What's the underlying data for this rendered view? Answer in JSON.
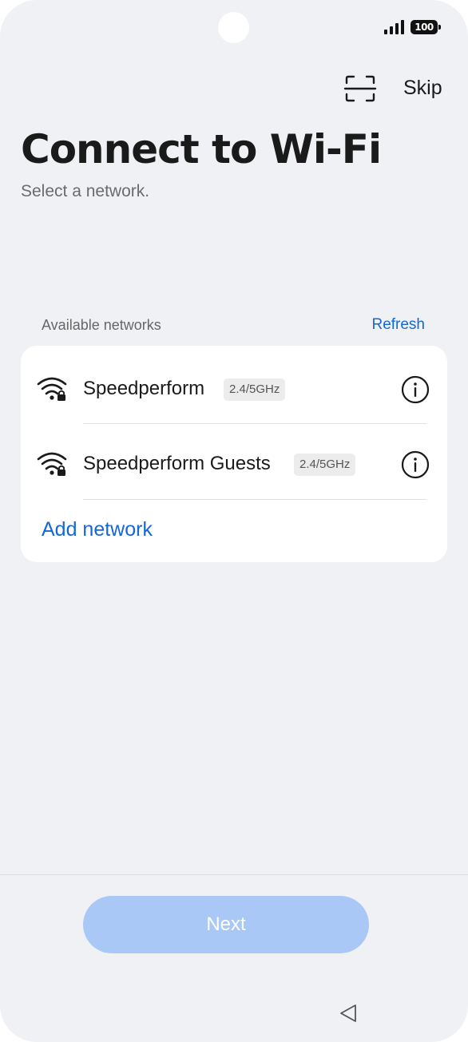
{
  "status_bar": {
    "battery_level": "100"
  },
  "header": {
    "skip_label": "Skip",
    "scan_icon": "qr-scan-icon"
  },
  "page": {
    "title": "Connect to Wi-Fi",
    "subtitle": "Select a network."
  },
  "networks_section": {
    "label": "Available networks",
    "refresh_label": "Refresh",
    "items": [
      {
        "name": "Speedperform",
        "band": "2.4/5GHz",
        "secured": true
      },
      {
        "name": "Speedperform Guests",
        "band": "2.4/5GHz",
        "secured": true
      }
    ],
    "add_network_label": "Add network"
  },
  "footer": {
    "next_label": "Next",
    "next_enabled": false
  },
  "colors": {
    "accent": "#1467d6",
    "next_disabled": "#a9c8f5",
    "background": "#f0f1f4"
  }
}
